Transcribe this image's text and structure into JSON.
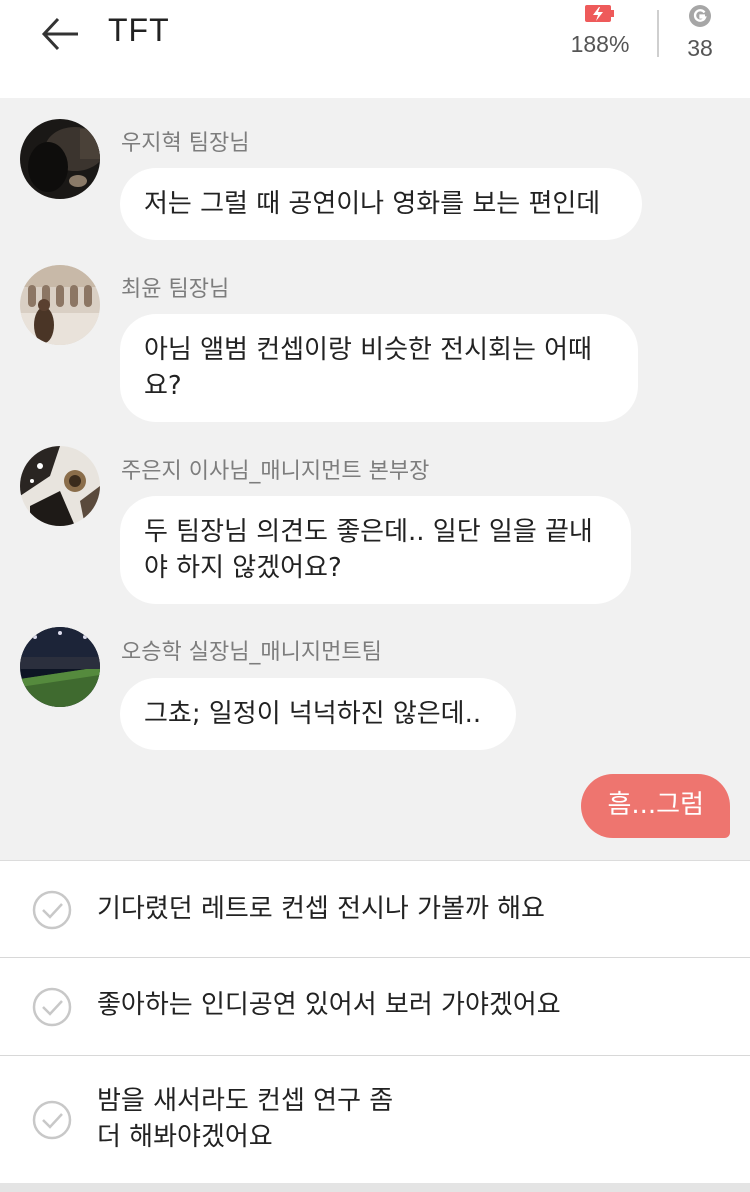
{
  "header": {
    "title": "TFT",
    "battery_value": "188%",
    "points_value": "38",
    "battery_color": "#ee5a5a"
  },
  "messages": [
    {
      "sender": "우지혁 팀장님",
      "text": "저는 그럴 때 공연이나 영화를 보는 편인데"
    },
    {
      "sender": "최윤 팀장님",
      "text": "아님 앨범 컨셉이랑 비슷한 전시회는 어때\n요?"
    },
    {
      "sender": "주은지 이사님_매니지먼트 본부장",
      "text": "두 팀장님 의견도 좋은데.. 일단 일을 끝내\n야 하지 않겠어요?"
    },
    {
      "sender": "오승학 실장님_매니지먼트팀",
      "text": "그쵸; 일정이 넉넉하진 않은데.."
    }
  ],
  "my_message": {
    "text": "흠...그럼",
    "color": "#ee756f"
  },
  "options": [
    {
      "text": "기다렸던 레트로 컨셉 전시나 가볼까 해요"
    },
    {
      "text": "좋아하는 인디공연 있어서 보러 가야겠어요"
    },
    {
      "text": "밤을 새서라도 컨셉 연구 좀\n더 해봐야겠어요"
    }
  ]
}
